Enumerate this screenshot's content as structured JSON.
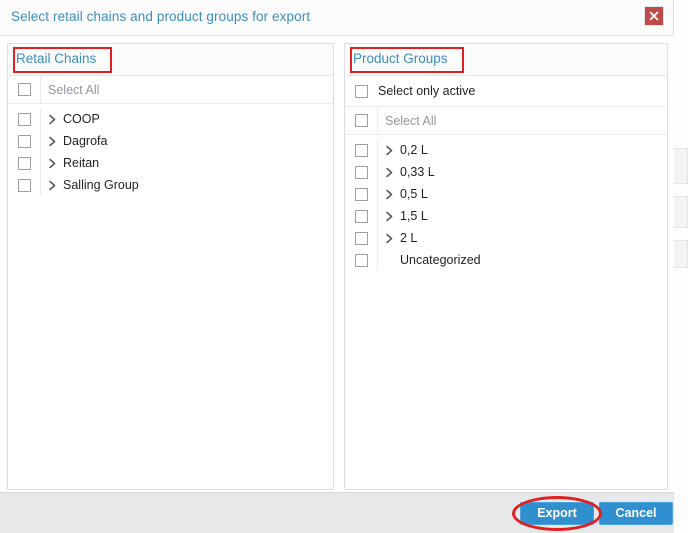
{
  "dialog": {
    "title": "Select retail chains and product groups for export",
    "close_icon": "close-icon"
  },
  "left_panel": {
    "title": "Retail Chains",
    "select_all_label": "Select All",
    "items": [
      {
        "label": "COOP",
        "expandable": true
      },
      {
        "label": "Dagrofa",
        "expandable": true
      },
      {
        "label": "Reitan",
        "expandable": true
      },
      {
        "label": "Salling Group",
        "expandable": true
      }
    ]
  },
  "right_panel": {
    "title": "Product Groups",
    "select_only_active_label": "Select only active",
    "select_all_label": "Select All",
    "items": [
      {
        "label": "0,2 L",
        "expandable": true
      },
      {
        "label": "0,33 L",
        "expandable": true
      },
      {
        "label": "0,5 L",
        "expandable": true
      },
      {
        "label": "1,5 L",
        "expandable": true
      },
      {
        "label": "2 L",
        "expandable": true
      },
      {
        "label": "Uncategorized",
        "expandable": false
      }
    ]
  },
  "footer": {
    "export_label": "Export",
    "cancel_label": "Cancel"
  },
  "colors": {
    "title_blue": "#3c8dbc",
    "button_blue": "#2f8fcf",
    "close_red": "#bf4a4a",
    "annotation_red": "#e02020",
    "footer_gray": "#e7e8ea"
  }
}
